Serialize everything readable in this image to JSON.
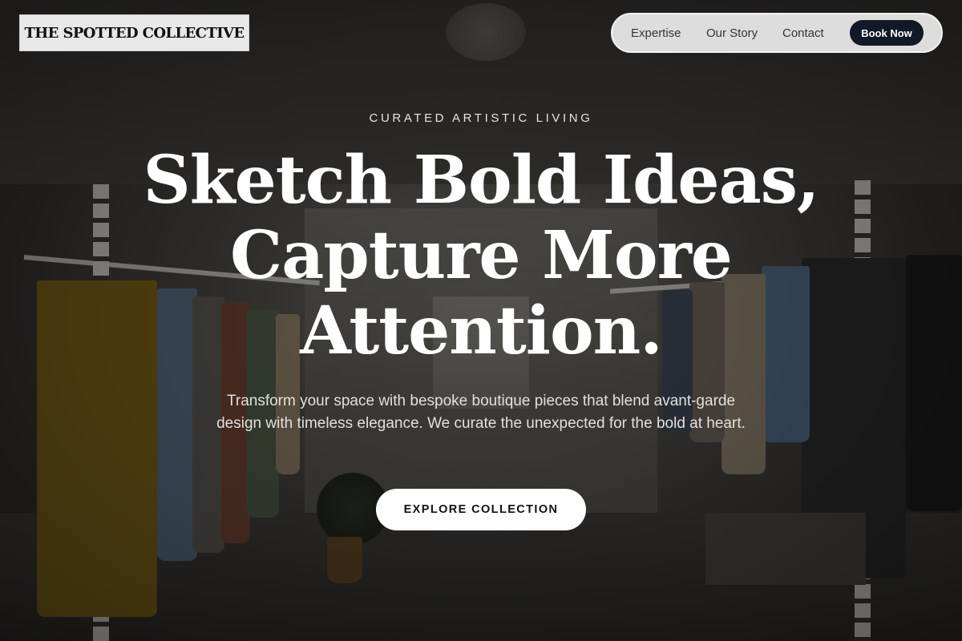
{
  "brand": {
    "logo_text": "THE SPOTTED COLLECTIVE"
  },
  "nav": {
    "items": [
      {
        "label": "Expertise"
      },
      {
        "label": "Our Story"
      },
      {
        "label": "Contact"
      }
    ],
    "cta_label": "Book Now"
  },
  "hero": {
    "eyebrow": "CURATED ARTISTIC LIVING",
    "headline_lines": [
      "Sketch Bold Ideas,",
      "Capture More",
      "Attention."
    ],
    "subtitle": "Transform your space with bespoke boutique pieces that blend avant-garde design with timeless elegance. We curate the unexpected for the bold at heart.",
    "cta_label": "EXPLORE COLLECTION",
    "background_image": "boutique clothing store interior with garment racks"
  },
  "colors": {
    "nav_button_bg": "#111827",
    "cta_bg": "#ffffff",
    "headline": "#ffffff"
  }
}
